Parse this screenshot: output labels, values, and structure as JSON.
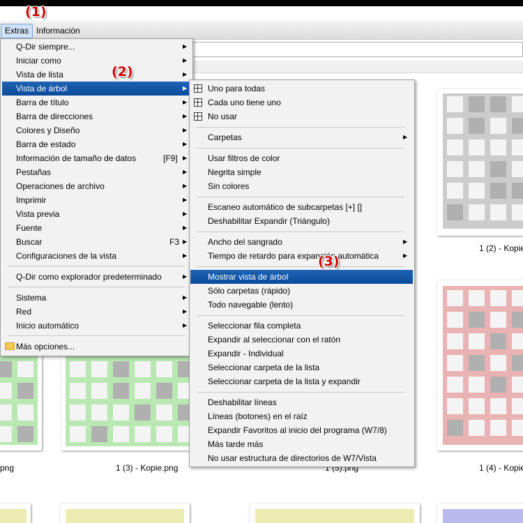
{
  "menubar": {
    "items": [
      {
        "label": "Extras",
        "active": true
      },
      {
        "label": "Información",
        "active": false
      }
    ]
  },
  "annotations": [
    "(1)",
    "(2)",
    "(3)"
  ],
  "main_menu": {
    "items": [
      {
        "label": "Q-Dir siempre...",
        "submenu": true
      },
      {
        "label": "Iniciar como",
        "submenu": true
      },
      {
        "label": "Vista de lista",
        "submenu": true
      },
      {
        "label": "Vista de árbol",
        "submenu": true,
        "highlighted": true
      },
      {
        "label": "Barra de título",
        "submenu": true
      },
      {
        "label": "Barra de direcciones",
        "submenu": true
      },
      {
        "label": "Colores y Diseño",
        "submenu": true
      },
      {
        "label": "Barra de estado",
        "submenu": true
      },
      {
        "label": "Información de tamaño de datos",
        "shortcut": "[F9]",
        "submenu": true
      },
      {
        "label": "Pestañas",
        "submenu": true
      },
      {
        "label": "Operaciones de archivo",
        "submenu": true
      },
      {
        "label": "Imprimir",
        "submenu": true
      },
      {
        "label": "Vista previa",
        "submenu": true
      },
      {
        "label": "Fuente",
        "submenu": true
      },
      {
        "label": "Buscar",
        "shortcut": "F3",
        "submenu": true
      },
      {
        "label": "Configuraciones de la vista",
        "submenu": true
      },
      {
        "label": "Q-Dir como explorador predeterminado",
        "submenu": true
      },
      {
        "label": "Sistema",
        "submenu": true
      },
      {
        "label": "Red",
        "submenu": true
      },
      {
        "label": "Inicio automático",
        "submenu": true
      },
      {
        "label": "Más opciones...",
        "submenu": false,
        "icon": "folder-icon"
      }
    ]
  },
  "sub_menu": {
    "items": [
      {
        "label": "Uno para todas",
        "icon": "grid-icon"
      },
      {
        "label": "Cada uno tiene uno",
        "icon": "grid-icon"
      },
      {
        "label": "No usar",
        "icon": "grid-icon"
      },
      {
        "label": "Carpetas",
        "submenu": true
      },
      {
        "label": "Usar filtros de color"
      },
      {
        "label": "Negrita simple"
      },
      {
        "label": "Sin colores"
      },
      {
        "label": "Escaneo automático de subcarpetas [+] []"
      },
      {
        "label": "Deshabilitar Expandir (Triángulo)"
      },
      {
        "label": "Ancho del sangrado",
        "submenu": true
      },
      {
        "label": "Tiempo de retardo para expansión automática",
        "submenu": true
      },
      {
        "label": "Mostrar vista de árbol",
        "highlighted": true
      },
      {
        "label": "Sólo carpetas (rápido)"
      },
      {
        "label": "Todo navegable (lento)"
      },
      {
        "label": "Seleccionar fila completa"
      },
      {
        "label": "Expandir al seleccionar con el ratón"
      },
      {
        "label": "Expandir - Individual"
      },
      {
        "label": "Seleccionar carpeta de la lista"
      },
      {
        "label": "Seleccionar carpeta de la lista y expandir"
      },
      {
        "label": "Deshabilitar líneas"
      },
      {
        "label": "Líneas (botones) en el raíz"
      },
      {
        "label": "Expandir Favoritos al inicio del programa (W7/8)"
      },
      {
        "label": "Más tarde más"
      },
      {
        "label": "No usar estructura de directorios de W7/Vista"
      }
    ]
  },
  "files": {
    "captions": [
      "1 (2) - Kopie",
      "png",
      "1 (3) - Kopie.png",
      "1 (5).png",
      "1 (4) - Kopie"
    ],
    "colors": {
      "gray": "#cccccc",
      "green": "#b9e8b2",
      "red": "#e9b3b3",
      "yellow": "#ecebb1",
      "blue": "#b9b9ee"
    }
  }
}
